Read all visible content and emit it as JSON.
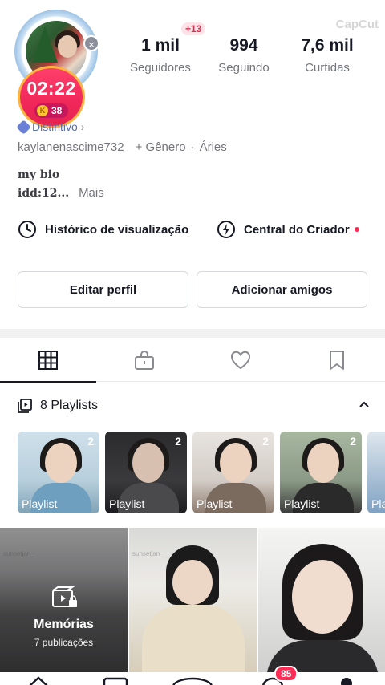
{
  "profile": {
    "timer": "02:22",
    "coins": "38",
    "coin_letter": "K",
    "username": "kaylanenascime732",
    "gender": "+ Gênero",
    "sign": "Áries",
    "badge_label": "Distintivo",
    "bio_line1": "my bio",
    "bio_line2": "idd:12...",
    "bio_more": "Mais"
  },
  "stats": {
    "followers_value": "1 mil",
    "followers_label": "Seguidores",
    "followers_new": "+13",
    "following_value": "994",
    "following_label": "Seguindo",
    "likes_value": "7,6 mil",
    "likes_label": "Curtidas"
  },
  "watermark": "CapCut",
  "links": {
    "history": "Histórico de visualização",
    "creator": "Central do Criador"
  },
  "buttons": {
    "edit": "Editar perfil",
    "add": "Adicionar amigos"
  },
  "tabs": [
    "videos-grid",
    "private-lock",
    "liked-heart",
    "saved-bookmark"
  ],
  "playlists": {
    "header": "8 Playlists",
    "items": [
      {
        "label": "Playlist",
        "count": "2"
      },
      {
        "label": "Playlist",
        "count": "2"
      },
      {
        "label": "Playlist",
        "count": "2"
      },
      {
        "label": "Playlist",
        "count": "2"
      },
      {
        "label": "Pla",
        "count": ""
      }
    ]
  },
  "grid": {
    "memories_title": "Memórias",
    "memories_sub": "7 publicações",
    "watermark_text": "sunsetjan_"
  },
  "bottom_nav": {
    "inbox_badge": "85"
  },
  "colors": {
    "accent": "#fe2c55",
    "text": "#161823",
    "muted": "#73757b"
  }
}
